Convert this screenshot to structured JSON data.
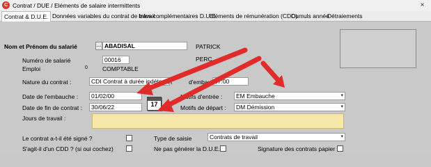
{
  "window": {
    "title": "Contrat / DUE / Eléments de salaire intermittents",
    "close_label": "×"
  },
  "tabs": [
    {
      "label": "Contrat & D.U.E."
    },
    {
      "label": "Données variables du contrat de travail"
    },
    {
      "label": "Infos complémentaires D.U.E."
    },
    {
      "label": "Eléments de rémunération (CDD)"
    },
    {
      "label": "Cumuls année"
    },
    {
      "label": "Détraiements"
    }
  ],
  "form": {
    "name_label": "Nom et Prénom du salarié",
    "name_btn": "...",
    "last_name": "ABADISAL",
    "first_name": "PATRICK",
    "first_name2": "PERC",
    "employee_number_label": "Numéro de salarié",
    "employee_number": "00016",
    "emploi_label": "Emploi",
    "emploi_code": "0",
    "emploi_value": "COMPTABLE",
    "nature_label": "Nature du contrat :",
    "nature_value": "CDI  Contrat à durée indéterminé",
    "heure_label": "H",
    "heure_label2": "d'embauche :",
    "heure_value": "07:00",
    "date_embauche_label": "Date de l'embauche :",
    "date_embauche": "01/02/00",
    "date_fin_label": "Date de fin de contrat :",
    "date_fin": "30/06/22",
    "calendar_day": "17",
    "motifs_entree_label": "Motifs d'entrée :",
    "motifs_entree": "EM  Embauche",
    "motifs_depart_label": "Motifs de départ :",
    "motifs_depart": "DM  Démission",
    "jours_label": "Jours de travail :",
    "signe_label": "Le contrat a-t-il été signé ?",
    "cdd_label": "S'agit-il d'un CDD ? (si oui cochez)",
    "type_saisie_label": "Type de saisie",
    "type_saisie_value": "Contrats de travail",
    "ne_pas_label": "Ne pas générer la D.U.E.",
    "signature_label": "Signature des contrats papier"
  }
}
